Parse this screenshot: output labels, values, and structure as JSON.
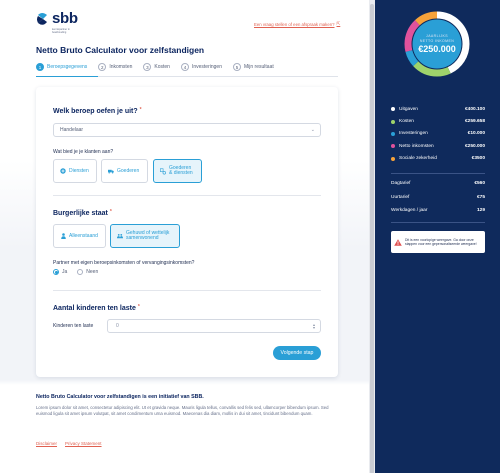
{
  "brand": {
    "name": "sbb",
    "tagline": "kennispartner in boekhouding",
    "colors": {
      "navy": "#0f2a5c",
      "accent": "#2a9fd6",
      "link": "#e06050"
    }
  },
  "top_link": {
    "label": "Een vraag stellen of een afspraak maken?",
    "icon": "external-link-icon"
  },
  "page_title": "Netto Bruto Calculator voor zelfstandigen",
  "steps": [
    {
      "num": "1",
      "label": "Beroepsgegevens",
      "active": true
    },
    {
      "num": "2",
      "label": "Inkomsten",
      "active": false
    },
    {
      "num": "3",
      "label": "Kosten",
      "active": false
    },
    {
      "num": "4",
      "label": "Investeringen",
      "active": false
    },
    {
      "num": "5",
      "label": "Mijn resultaat",
      "active": false
    }
  ],
  "section_beroep": {
    "title": "Welk beroep oefen je uit?",
    "required_mark": "*",
    "select_value": "Handelaar",
    "question": "Wat bied je je klanten aan?",
    "options": [
      {
        "label": "Diensten",
        "icon": "plus-circle-icon",
        "selected": false
      },
      {
        "label": "Goederen",
        "icon": "truck-icon",
        "selected": false
      },
      {
        "label": "Goederen & diensten",
        "line1": "Goederen",
        "line2": "& diensten",
        "icon": "goods-services-icon",
        "selected": true
      }
    ]
  },
  "section_burgerlijk": {
    "title": "Burgerlijke staat",
    "required_mark": "*",
    "options": [
      {
        "label": "Alleenstaand",
        "icon": "person-icon",
        "selected": false
      },
      {
        "line1": "Gehuwd of wettelijk",
        "line2": "samenwonend",
        "icon": "couple-icon",
        "selected": true
      }
    ],
    "partner_question": "Partner met eigen beroepsinkomsten of vervangingsinkomsten?",
    "radio": [
      {
        "label": "Ja",
        "checked": true
      },
      {
        "label": "Neen",
        "checked": false
      }
    ]
  },
  "section_kinderen": {
    "title": "Aantal kinderen ten laste",
    "required_mark": "*",
    "field_label": "Kinderen ten laste",
    "value": "0"
  },
  "next_button": "Volgende stap",
  "footer": {
    "title": "Netto Bruto Calculator voor zelfstandigen is een initiatief van SBB.",
    "text": "Lorem ipsum dolor sit amet, consectetur adipiscing elit. Ut et gravida neque. Mauris ligula tellus, convallis sed felis sed, ullamcorper bibendum ipsum. Sed euismod ligula sit amet ipsum volutpat, sit amet condimentum urna euismod. Maecenas dia diam, mollis in dui sit amet, tincidunt bibendum quam.",
    "links": [
      "Disclaimer",
      "Privacy Statement"
    ]
  },
  "summary": {
    "caption_line1": "JAARLIJKS",
    "caption_line2": "NETTO INKOMEN",
    "amount": "€250.000",
    "legend": [
      {
        "name": "Uitgaven",
        "value": "€400.100",
        "color": "#ffffff",
        "share": 0.43
      },
      {
        "name": "Kosten",
        "value": "€259.658",
        "color": "#9fd36b",
        "share": 0.2
      },
      {
        "name": "Investeringen",
        "value": "€10.000",
        "color": "#2a9fd6",
        "share": 0.08
      },
      {
        "name": "Netto inkomsten",
        "value": "€250.000",
        "color": "#e0529c",
        "share": 0.17
      },
      {
        "name": "Sociale zekerheid",
        "value": "€3500",
        "color": "#f6a23a",
        "share": 0.12
      }
    ],
    "rates": [
      {
        "name": "Dagtarief",
        "value": "€560"
      },
      {
        "name": "Uurtarief",
        "value": "€75"
      },
      {
        "name": "Werkdagen / jaar",
        "value": "129"
      }
    ],
    "warning": "Dit is een voorlopige weergave. Ga door onze stappen voor een gepersonaliseerde weergave!"
  }
}
